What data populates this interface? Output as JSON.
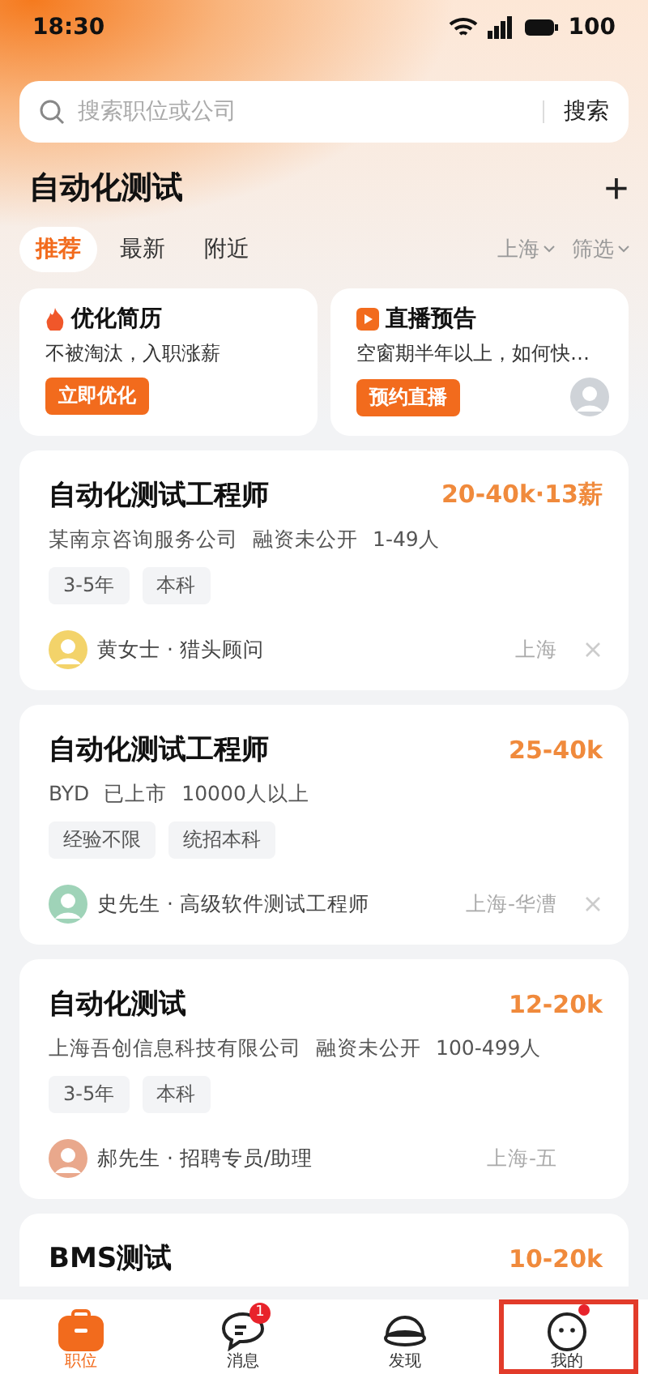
{
  "status_bar": {
    "time": "18:30",
    "battery": "100"
  },
  "search": {
    "placeholder": "搜索职位或公司",
    "button": "搜索"
  },
  "header": {
    "title": "自动化测试",
    "add": "+"
  },
  "tabs": [
    {
      "label": "推荐",
      "selected": true
    },
    {
      "label": "最新",
      "selected": false
    },
    {
      "label": "附近",
      "selected": false
    }
  ],
  "filters": [
    {
      "label": "上海"
    },
    {
      "label": "筛选"
    }
  ],
  "promos": [
    {
      "kind": "resume",
      "title": "优化简历",
      "subtitle": "不被淘汰，入职涨薪",
      "button": "立即优化"
    },
    {
      "kind": "live",
      "title": "直播预告",
      "subtitle": "空窗期半年以上，如何快…",
      "button": "预约直播"
    }
  ],
  "jobs": [
    {
      "title": "自动化测试工程师",
      "salary": "20-40k·13薪",
      "company": [
        "某南京咨询服务公司",
        "融资未公开",
        "1-49人"
      ],
      "tags": [
        "3-5年",
        "本科"
      ],
      "recruiter": "黄女士 · 猎头顾问",
      "color": "#f3d36a",
      "location": "上海",
      "dismissable": true
    },
    {
      "title": "自动化测试工程师",
      "salary": "25-40k",
      "company": [
        "BYD",
        "已上市",
        "10000人以上"
      ],
      "tags": [
        "经验不限",
        "统招本科"
      ],
      "recruiter": "史先生 · 高级软件测试工程师",
      "color": "#9fd3b8",
      "location": "上海-华漕",
      "dismissable": true
    },
    {
      "title": "自动化测试",
      "salary": "12-20k",
      "company": [
        "上海吾创信息科技有限公司",
        "融资未公开",
        "100-499人"
      ],
      "tags": [
        "3-5年",
        "本科"
      ],
      "recruiter": "郝先生 · 招聘专员/助理",
      "color": "#e9a88c",
      "location": "上海-五",
      "dismissable": false
    },
    {
      "title": "BMS测试",
      "salary": "10-20k"
    }
  ],
  "nav": [
    {
      "kind": "jobs",
      "label": "职位",
      "selected": true
    },
    {
      "kind": "messages",
      "label": "消息",
      "selected": false,
      "badge": "1"
    },
    {
      "kind": "discover",
      "label": "发现",
      "selected": false
    },
    {
      "kind": "me",
      "label": "我的",
      "selected": false,
      "dot": true,
      "highlighted": true
    }
  ]
}
